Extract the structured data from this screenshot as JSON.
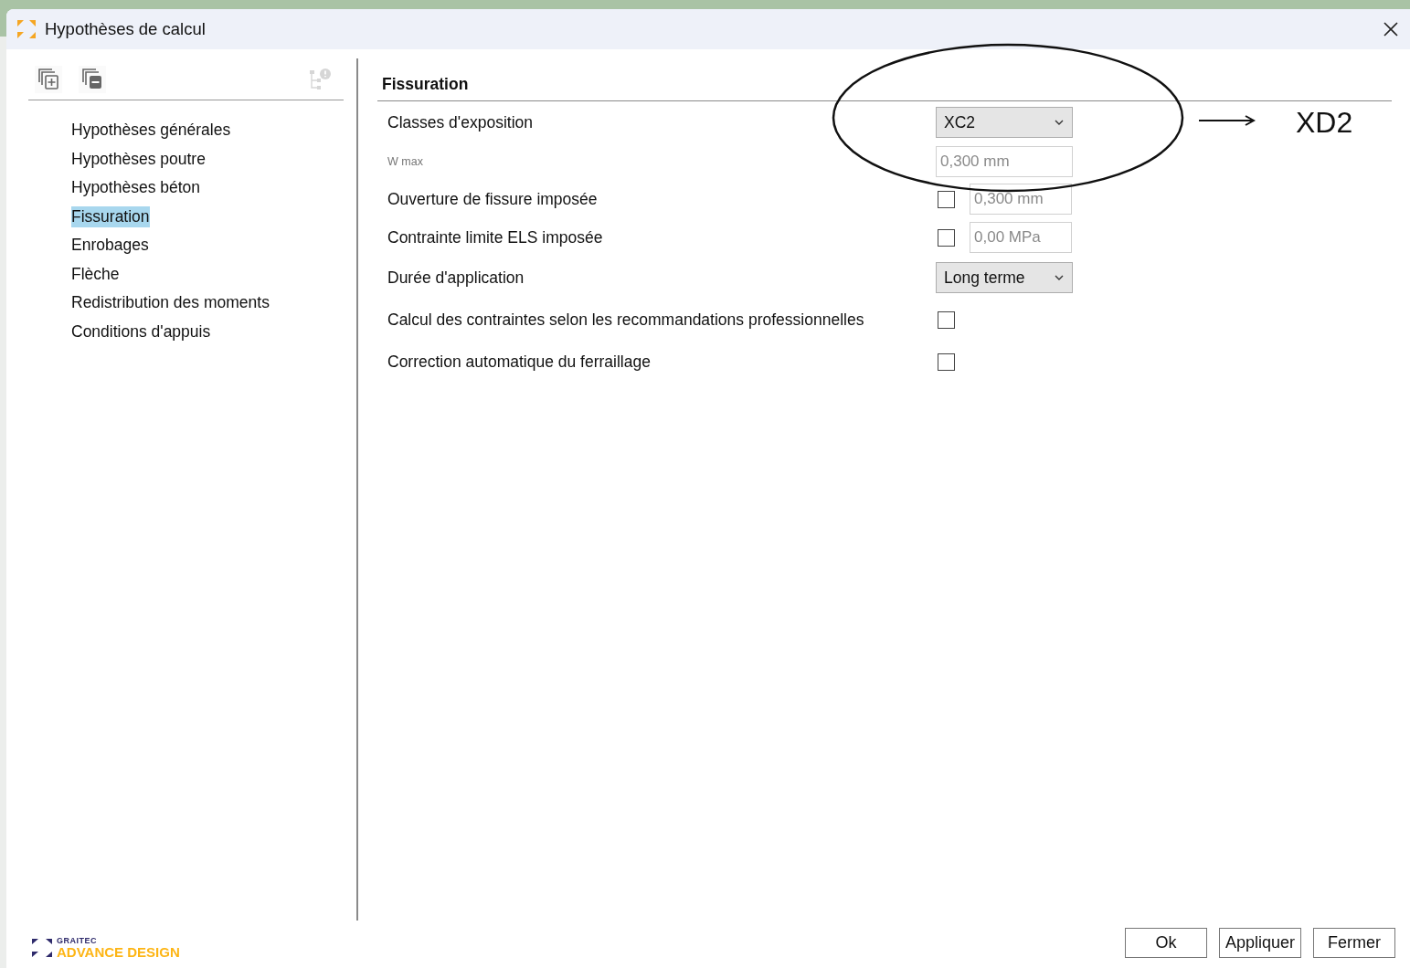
{
  "window": {
    "title": "Hypothèses de calcul"
  },
  "toolbar": [
    {
      "kind": "add",
      "disabled": false
    },
    {
      "kind": "remove",
      "disabled": false
    },
    {
      "kind": "warning",
      "disabled": true
    }
  ],
  "sidebar": {
    "items": [
      {
        "label": "Hypothèses générales",
        "selected": false
      },
      {
        "label": "Hypothèses poutre",
        "selected": false
      },
      {
        "label": "Hypothèses béton",
        "selected": false
      },
      {
        "label": "Fissuration",
        "selected": true
      },
      {
        "label": "Enrobages",
        "selected": false
      },
      {
        "label": "Flèche",
        "selected": false
      },
      {
        "label": "Redistribution des moments",
        "selected": false
      },
      {
        "label": "Conditions d'appuis",
        "selected": false
      }
    ]
  },
  "section": {
    "title": "Fissuration"
  },
  "rows": [
    {
      "kind": "select",
      "label": "Classes d'exposition",
      "value": "XC2"
    },
    {
      "kind": "field",
      "label": "W max",
      "value": "0,300 mm"
    },
    {
      "kind": "check-field",
      "label": "Ouverture de fissure imposée",
      "checked": false,
      "value": "0,300 mm"
    },
    {
      "kind": "check-field",
      "label": "Contrainte limite ELS imposée",
      "checked": false,
      "value": "0,00 MPa"
    },
    {
      "kind": "select",
      "label": "Durée d'application",
      "value": "Long terme"
    },
    {
      "kind": "checkbox",
      "label": "Calcul des contraintes selon les recommandations professionnelles",
      "checked": false
    },
    {
      "kind": "checkbox",
      "label": "Correction automatique du ferraillage",
      "checked": false
    }
  ],
  "annotation": {
    "text": "XD2"
  },
  "logo": {
    "brand": "GRAITEC",
    "product": "ADVANCE DESIGN"
  },
  "buttons": [
    "Ok",
    "Appliquer",
    "Fermer"
  ]
}
